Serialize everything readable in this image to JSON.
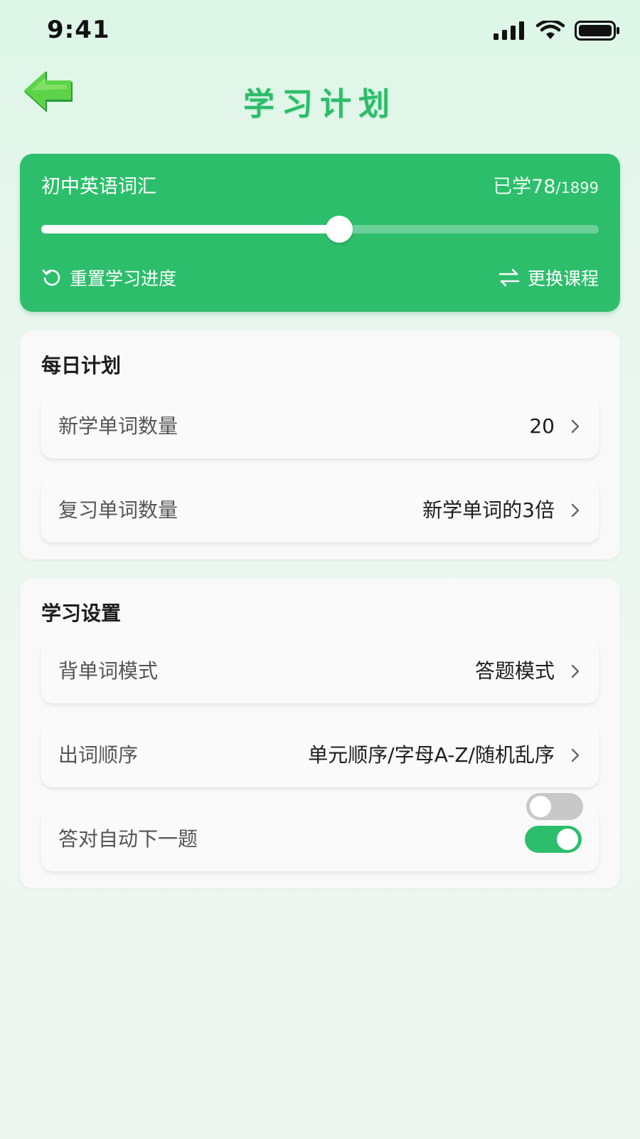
{
  "status_bar": {
    "time": "9:41"
  },
  "header": {
    "title": "学习计划"
  },
  "course": {
    "name": "初中英语词汇",
    "learned_prefix": "已学",
    "learned": "78",
    "total": "/1899",
    "progress_fraction": 0.535,
    "reset_label": "重置学习进度",
    "switch_label": "更换课程"
  },
  "daily_plan": {
    "title": "每日计划",
    "rows": [
      {
        "label": "新学单词数量",
        "value": "20"
      },
      {
        "label": "复习单词数量",
        "value": "新学单词的3倍"
      }
    ]
  },
  "study_settings": {
    "title": "学习设置",
    "rows": [
      {
        "label": "背单词模式",
        "value": "答题模式"
      },
      {
        "label": "出词顺序",
        "value": "单元顺序/字母A-Z/随机乱序"
      }
    ],
    "auto_next": {
      "label": "答对自动下一题",
      "enabled": true
    }
  },
  "colors": {
    "accent": "#2dbe6c",
    "title": "#2dbc6a",
    "toggle_off": "#c8c8c8"
  }
}
